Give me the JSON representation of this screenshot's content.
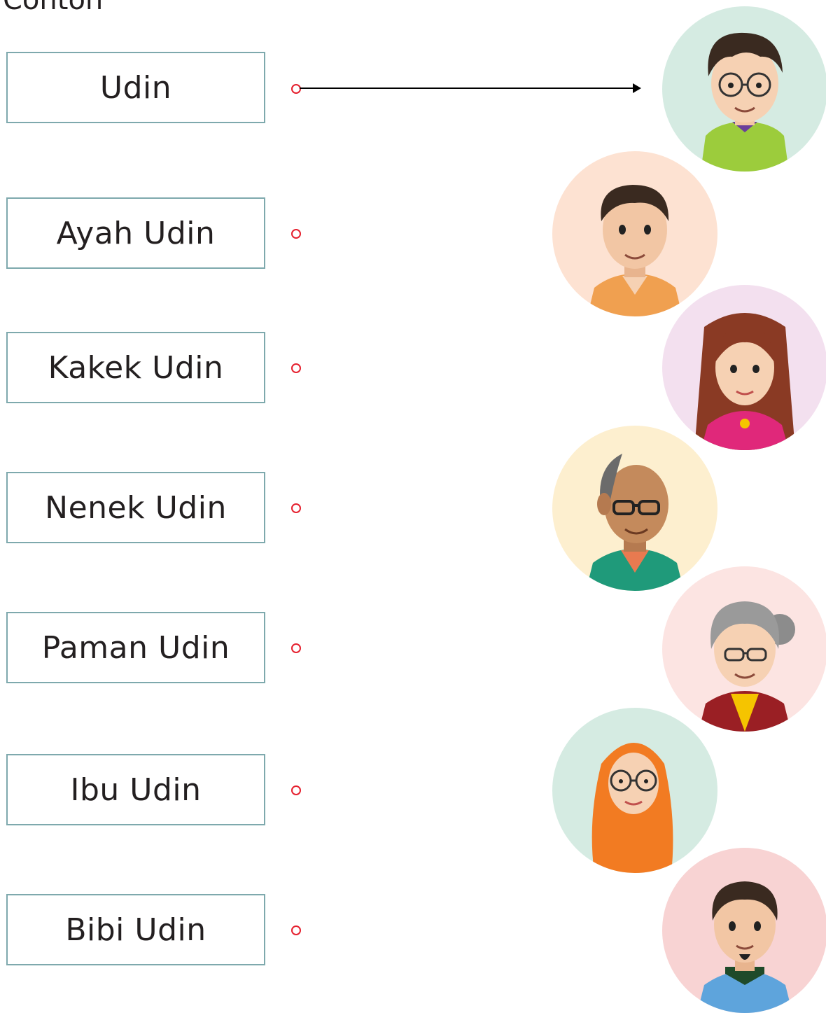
{
  "heading": "Contoh",
  "labels": [
    {
      "text": "Udin"
    },
    {
      "text": "Ayah Udin"
    },
    {
      "text": "Kakek Udin"
    },
    {
      "text": "Nenek Udin"
    },
    {
      "text": "Paman Udin"
    },
    {
      "text": "Ibu Udin"
    },
    {
      "text": "Bibi Udin"
    }
  ],
  "colors": {
    "box_border": "#7ea9ad",
    "dot": "#e5202e",
    "portrait_backgrounds": [
      "#d5ebe2",
      "#fde2d2",
      "#f3e0ef",
      "#fdefcf",
      "#fce4e2",
      "#d5ebe2",
      "#f8d3d3"
    ]
  },
  "portraits": [
    {
      "icon": "boy-glasses-icon"
    },
    {
      "icon": "young-man-icon"
    },
    {
      "icon": "long-hair-woman-icon"
    },
    {
      "icon": "old-man-glasses-icon"
    },
    {
      "icon": "old-woman-glasses-icon"
    },
    {
      "icon": "hijab-woman-glasses-icon"
    },
    {
      "icon": "man-goatee-icon"
    }
  ]
}
